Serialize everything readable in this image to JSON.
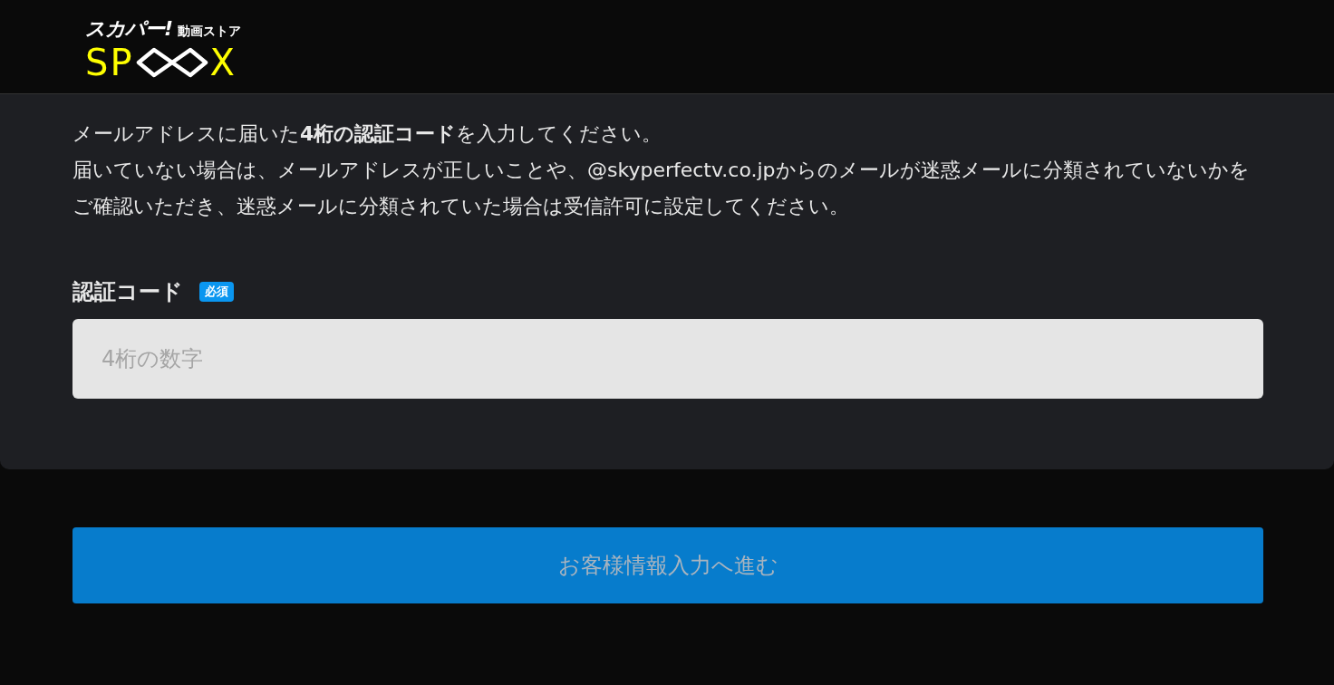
{
  "header": {
    "logo": {
      "brand": "スカパー!",
      "subtitle": "動画ストア",
      "wordmark_start": "SP",
      "wordmark_end": "X"
    }
  },
  "instructions": [
    "メールアドレスに届いた**4桁の認証コード**を入力してください。",
    "届いていない場合は、メールアドレスが正しいことや、@skyperfectv.co.jpからのメールが迷惑メールに分類されていないかをご確認いただき、迷惑メールに分類されていた場合は受信許可に設定してください。"
  ],
  "field": {
    "label": "認証コード",
    "badge": "必須",
    "placeholder": "4桁の数字"
  },
  "submit_button": {
    "label": "お客様情報入力へ進む",
    "disabled": true
  }
}
